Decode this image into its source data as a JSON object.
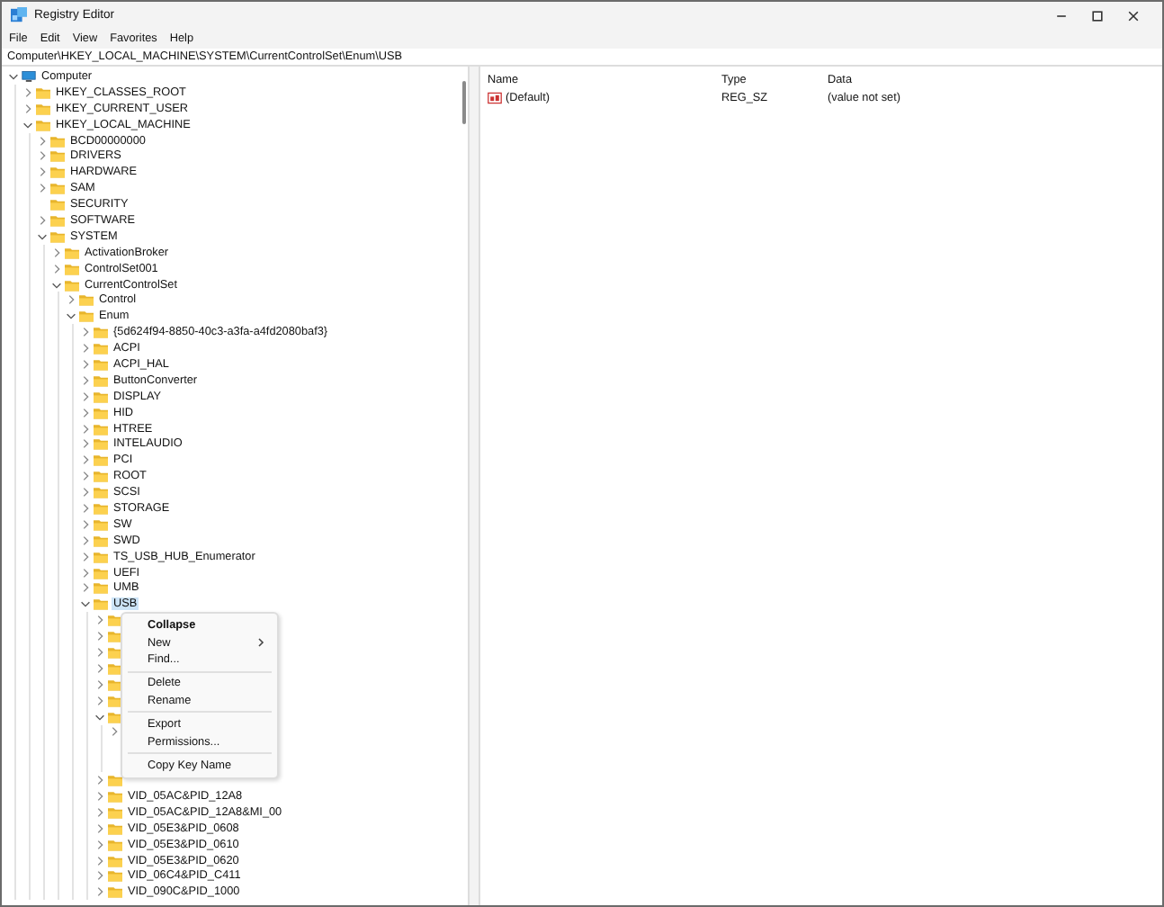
{
  "window": {
    "title": "Registry Editor"
  },
  "menu_bar": [
    "File",
    "Edit",
    "View",
    "Favorites",
    "Help"
  ],
  "address": "Computer\\HKEY_LOCAL_MACHINE\\SYSTEM\\CurrentControlSet\\Enum\\USB",
  "tree": [
    {
      "label": "Computer",
      "kind": "computer",
      "expanded": true,
      "selected": false,
      "children": [
        {
          "label": "HKEY_CLASSES_ROOT",
          "expanded": false,
          "selected": false
        },
        {
          "label": "HKEY_CURRENT_USER",
          "expanded": false,
          "selected": false
        },
        {
          "label": "HKEY_LOCAL_MACHINE",
          "expanded": true,
          "selected": false,
          "children": [
            {
              "label": "BCD00000000",
              "expanded": false,
              "selected": false
            },
            {
              "label": "DRIVERS",
              "expanded": false,
              "selected": false
            },
            {
              "label": "HARDWARE",
              "expanded": false,
              "selected": false
            },
            {
              "label": "SAM",
              "expanded": false,
              "selected": false
            },
            {
              "label": "SECURITY",
              "leaf": true,
              "selected": false
            },
            {
              "label": "SOFTWARE",
              "expanded": false,
              "selected": false
            },
            {
              "label": "SYSTEM",
              "expanded": true,
              "selected": false,
              "children": [
                {
                  "label": "ActivationBroker",
                  "expanded": false,
                  "selected": false
                },
                {
                  "label": "ControlSet001",
                  "expanded": false,
                  "selected": false
                },
                {
                  "label": "CurrentControlSet",
                  "expanded": true,
                  "selected": false,
                  "children": [
                    {
                      "label": "Control",
                      "expanded": false,
                      "selected": false
                    },
                    {
                      "label": "Enum",
                      "expanded": true,
                      "selected": false,
                      "children": [
                        {
                          "label": "{5d624f94-8850-40c3-a3fa-a4fd2080baf3}",
                          "expanded": false,
                          "selected": false
                        },
                        {
                          "label": "ACPI",
                          "expanded": false,
                          "selected": false
                        },
                        {
                          "label": "ACPI_HAL",
                          "expanded": false,
                          "selected": false
                        },
                        {
                          "label": "ButtonConverter",
                          "expanded": false,
                          "selected": false
                        },
                        {
                          "label": "DISPLAY",
                          "expanded": false,
                          "selected": false
                        },
                        {
                          "label": "HID",
                          "expanded": false,
                          "selected": false
                        },
                        {
                          "label": "HTREE",
                          "expanded": false,
                          "selected": false
                        },
                        {
                          "label": "INTELAUDIO",
                          "expanded": false,
                          "selected": false
                        },
                        {
                          "label": "PCI",
                          "expanded": false,
                          "selected": false
                        },
                        {
                          "label": "ROOT",
                          "expanded": false,
                          "selected": false
                        },
                        {
                          "label": "SCSI",
                          "expanded": false,
                          "selected": false
                        },
                        {
                          "label": "STORAGE",
                          "expanded": false,
                          "selected": false
                        },
                        {
                          "label": "SW",
                          "expanded": false,
                          "selected": false
                        },
                        {
                          "label": "SWD",
                          "expanded": false,
                          "selected": false
                        },
                        {
                          "label": "TS_USB_HUB_Enumerator",
                          "expanded": false,
                          "selected": false
                        },
                        {
                          "label": "UEFI",
                          "expanded": false,
                          "selected": false
                        },
                        {
                          "label": "UMB",
                          "expanded": false,
                          "selected": false
                        },
                        {
                          "label": "USB",
                          "expanded": true,
                          "selected": true,
                          "children": [
                            {
                              "expanded": false
                            },
                            {
                              "expanded": false
                            },
                            {
                              "expanded": false
                            },
                            {
                              "expanded": false
                            },
                            {
                              "expanded": false
                            },
                            {
                              "expanded": false
                            },
                            {
                              "expanded": true,
                              "children": [
                                {
                                  "expanded": false
                                },
                                {
                                  "leaf": true
                                },
                                {
                                  "leaf": true
                                }
                              ]
                            },
                            {
                              "expanded": false
                            },
                            {
                              "label": "VID_05AC&PID_12A8",
                              "expanded": false,
                              "selected": false
                            },
                            {
                              "label": "VID_05AC&PID_12A8&MI_00",
                              "expanded": false,
                              "selected": false
                            },
                            {
                              "label": "VID_05E3&PID_0608",
                              "expanded": false,
                              "selected": false
                            },
                            {
                              "label": "VID_05E3&PID_0610",
                              "expanded": false,
                              "selected": false
                            },
                            {
                              "label": "VID_05E3&PID_0620",
                              "expanded": false,
                              "selected": false
                            },
                            {
                              "label": "VID_06C4&PID_C411",
                              "expanded": false,
                              "selected": false
                            },
                            {
                              "label": "VID_090C&PID_1000",
                              "expanded": false,
                              "selected": false
                            }
                          ]
                        }
                      ]
                    }
                  ]
                }
              ]
            }
          ]
        }
      ]
    }
  ],
  "values_table": {
    "columns": [
      "Name",
      "Type",
      "Data"
    ],
    "rows": [
      {
        "name": "(Default)",
        "type": "REG_SZ",
        "data": "(value not set)"
      }
    ]
  },
  "context_menu": [
    {
      "label": "Collapse",
      "kind": "default"
    },
    {
      "label": "New",
      "kind": "submenu"
    },
    {
      "label": "Find...",
      "kind": "item"
    },
    {
      "kind": "separator"
    },
    {
      "label": "Delete",
      "kind": "item"
    },
    {
      "label": "Rename",
      "kind": "item"
    },
    {
      "kind": "separator"
    },
    {
      "label": "Export",
      "kind": "item"
    },
    {
      "label": "Permissions...",
      "kind": "item"
    },
    {
      "kind": "separator"
    },
    {
      "label": "Copy Key Name",
      "kind": "item"
    }
  ]
}
